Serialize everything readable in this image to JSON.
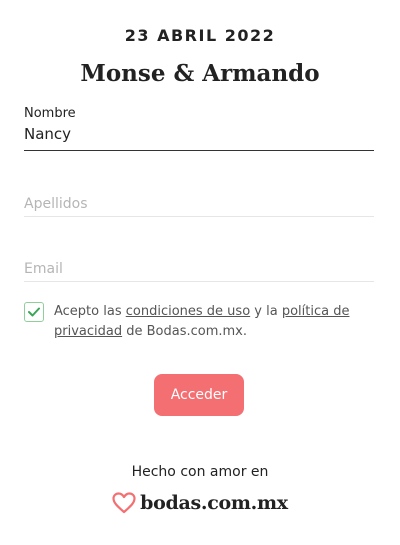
{
  "header": {
    "date": "23 ABRIL 2022",
    "couple": "Monse & Armando"
  },
  "form": {
    "nombre": {
      "label": "Nombre",
      "value": "Nancy"
    },
    "apellidos": {
      "placeholder": "Apellidos"
    },
    "email": {
      "placeholder": "Email"
    },
    "consent": {
      "checked": true,
      "text_1": "Acepto las ",
      "link_1": "condiciones de uso",
      "text_2": " y la ",
      "link_2": "política de privacidad",
      "text_3": " de Bodas.com.mx."
    },
    "submit_label": "Acceder"
  },
  "footer": {
    "made_with": "Hecho con amor en",
    "brand": "bodas.com.mx"
  },
  "colors": {
    "accent": "#f46f72",
    "check": "#3aa757"
  }
}
